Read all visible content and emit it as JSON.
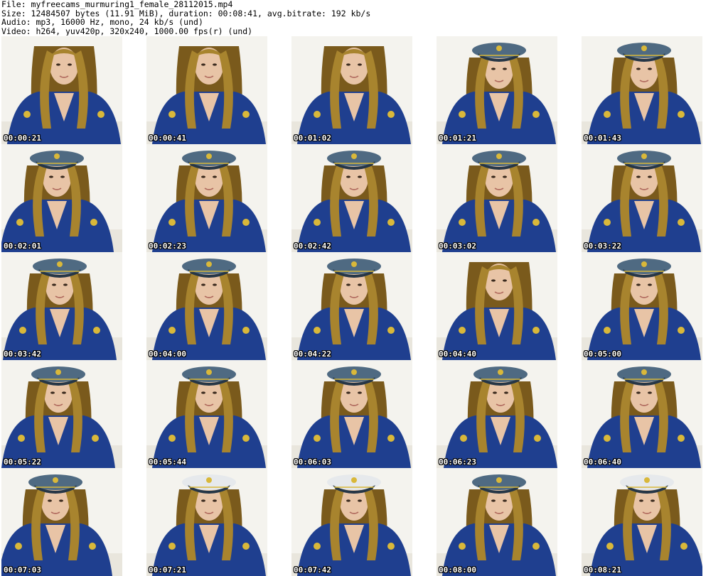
{
  "header": {
    "file_line": "File: myfreecams_murmuring1_female_28112015.mp4",
    "size_line": "Size: 12484507 bytes (11.91 MiB), duration: 00:08:41, avg.bitrate: 192 kb/s",
    "audio_line": "Audio: mp3, 16000 Hz, mono, 24 kb/s (und)",
    "video_line": "Video: h264, yuv420p, 320x240, 1000.00 fps(r) (und)"
  },
  "thumbnails": [
    {
      "timestamp": "00:00:21"
    },
    {
      "timestamp": "00:00:41"
    },
    {
      "timestamp": "00:01:02"
    },
    {
      "timestamp": "00:01:21"
    },
    {
      "timestamp": "00:01:43"
    },
    {
      "timestamp": "00:02:01"
    },
    {
      "timestamp": "00:02:23"
    },
    {
      "timestamp": "00:02:42"
    },
    {
      "timestamp": "00:03:02"
    },
    {
      "timestamp": "00:03:22"
    },
    {
      "timestamp": "00:03:42"
    },
    {
      "timestamp": "00:04:00"
    },
    {
      "timestamp": "00:04:22"
    },
    {
      "timestamp": "00:04:40"
    },
    {
      "timestamp": "00:05:00"
    },
    {
      "timestamp": "00:05:22"
    },
    {
      "timestamp": "00:05:44"
    },
    {
      "timestamp": "00:06:03"
    },
    {
      "timestamp": "00:06:23"
    },
    {
      "timestamp": "00:06:40"
    },
    {
      "timestamp": "00:07:03"
    },
    {
      "timestamp": "00:07:21"
    },
    {
      "timestamp": "00:07:42"
    },
    {
      "timestamp": "00:08:00"
    },
    {
      "timestamp": "00:08:21"
    }
  ],
  "colors": {
    "background": "#ffffff",
    "wall": "#f4f3ee",
    "hair": "#a8842e",
    "hair_dark": "#7a5a1c",
    "skin": "#e8c4a6",
    "uniform": "#1f3f8f",
    "cap": "#4f6a82",
    "cap_white": "#e6e9ec",
    "insignia": "#d9b83a"
  }
}
